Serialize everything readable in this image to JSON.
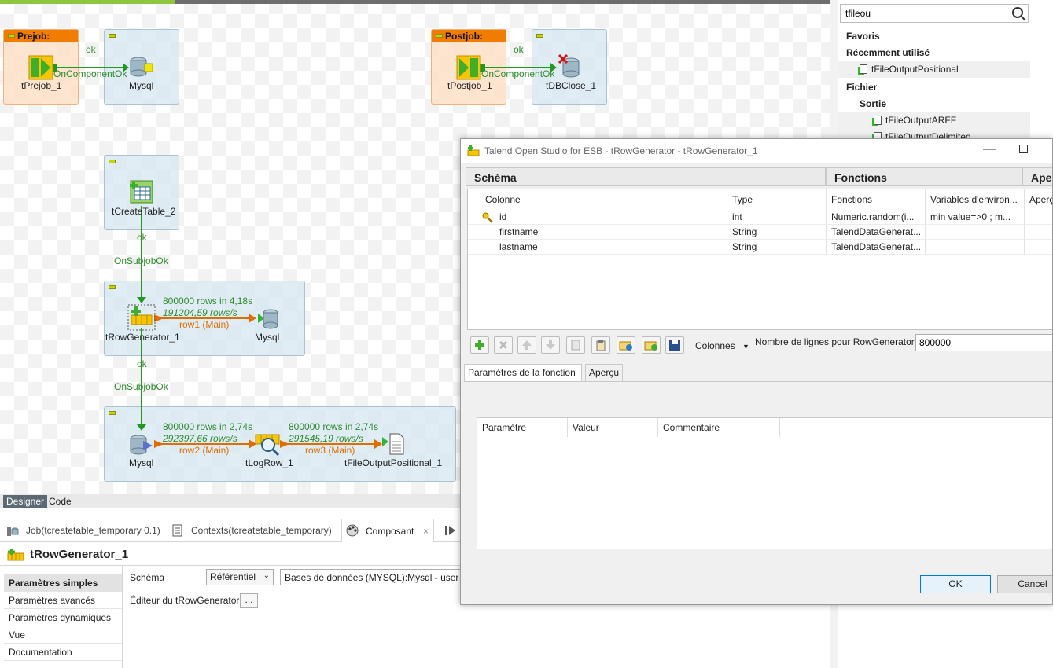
{
  "canvas": {
    "prejob": {
      "header": "Prejob:",
      "start_label": "tPrejob_1",
      "target_label": "Mysql",
      "link_ok": "ok",
      "link_trigger": "OnComponentOk"
    },
    "postjob": {
      "header": "Postjob:",
      "start_label": "tPostjob_1",
      "target_label": "tDBClose_1",
      "link_ok": "ok",
      "link_trigger": "OnComponentOk"
    },
    "subjob_create": {
      "label": "tCreateTable_2"
    },
    "link_subjob_1": {
      "ok": "ok",
      "trigger": "OnSubjobOk"
    },
    "subjob_gen": {
      "source_label": "tRowGenerator_1",
      "target_label": "Mysql",
      "stat_rows": "800000 rows in 4,18s",
      "stat_rate": "191204,59 rows/s",
      "row_label": "row1 (Main)"
    },
    "link_subjob_2": {
      "ok": "ok",
      "trigger": "OnSubjobOk"
    },
    "subjob_out": {
      "source_label": "Mysql",
      "log_label": "tLogRow_1",
      "file_label": "tFileOutputPositional_1",
      "stat1_rows": "800000 rows in 2,74s",
      "stat1_rate": "292397,66 rows/s",
      "row2_label": "row2 (Main)",
      "stat2_rows": "800000 rows in 2,74s",
      "stat2_rate": "291545,19 rows/s",
      "row3_label": "row3 (Main)"
    }
  },
  "editor_tabs": {
    "designer": "Designer",
    "code": "Code"
  },
  "view_tabs": {
    "job": "Job(tcreatetable_temporary 0.1)",
    "contexts": "Contexts(tcreatetable_temporary)",
    "component": "Composant"
  },
  "component_panel": {
    "title": "tRowGenerator_1",
    "side_items": [
      "Paramètres simples",
      "Paramètres avancés",
      "Paramètres dynamiques",
      "Vue",
      "Documentation"
    ],
    "schema_label": "Schéma",
    "schema_mode": "Référentiel",
    "schema_value": "Bases de données (MYSQL):Mysql - user",
    "editor_label": "Éditeur du tRowGenerator",
    "editor_button": "..."
  },
  "palette": {
    "search_value": "tfileou",
    "items": [
      {
        "label": "Favoris",
        "kind": "head"
      },
      {
        "label": "Récemment utilisé",
        "kind": "head"
      },
      {
        "label": "tFileOutputPositional",
        "kind": "leaf"
      },
      {
        "label": "Fichier",
        "kind": "head"
      },
      {
        "label": "Sortie",
        "kind": "head2"
      },
      {
        "label": "tFileOutputARFF",
        "kind": "leaf2"
      },
      {
        "label": "tFileOutputDelimited",
        "kind": "leaf2"
      }
    ]
  },
  "dialog": {
    "title": "Talend Open Studio for ESB - tRowGenerator - tRowGenerator_1",
    "section_schema": "Schéma",
    "section_functions": "Fonctions",
    "section_preview": "Aperçu",
    "columns": [
      "Colonne",
      "Type",
      "Fonctions",
      "Variables d'environ...",
      "Aperçu"
    ],
    "rows": [
      {
        "name": "id",
        "type": "int",
        "function": "Numeric.random(i...",
        "vars": "min value=>0 ; m...",
        "key": true
      },
      {
        "name": "firstname",
        "type": "String",
        "function": "TalendDataGenerat...",
        "vars": "",
        "key": false
      },
      {
        "name": "lastname",
        "type": "String",
        "function": "TalendDataGenerat...",
        "vars": "",
        "key": false
      }
    ],
    "columns_dropdown": "Colonnes",
    "rows_count_label": "Nombre de lignes pour RowGenerator",
    "rows_count_value": "800000",
    "param_tabs": [
      "Paramètres de la fonction",
      "Aperçu"
    ],
    "param_columns": [
      "Paramètre",
      "Valeur",
      "Commentaire"
    ],
    "ok_label": "OK",
    "cancel_label": "Cancel"
  },
  "colors": {
    "accent_orange": "#f07c00",
    "link_green": "#2e8b2e",
    "main_orange": "#e06d00",
    "subjob_blue": "#d6e6f0"
  }
}
